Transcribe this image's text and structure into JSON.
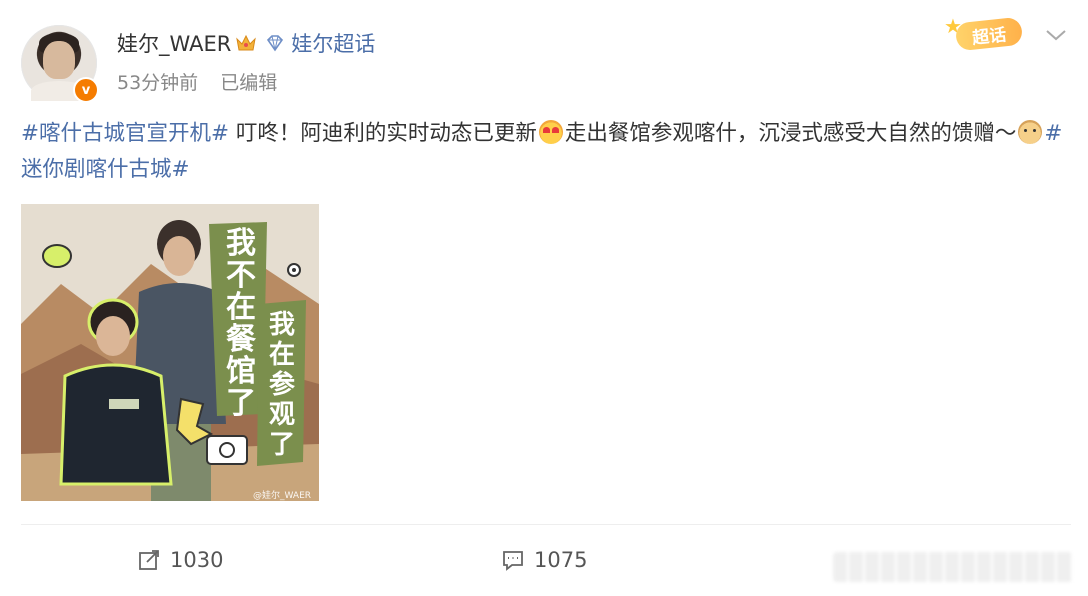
{
  "post": {
    "username": "娃尔_WAER",
    "super_topic_link": "娃尔超话",
    "time": "53分钟前",
    "edited": "已编辑",
    "verified_badge": "v",
    "super_badge": "超话",
    "text": {
      "tag1": "#喀什古城官宣开机#",
      "body1": " 叮咚！阿迪利的实时动态已更新",
      "body2": "走出餐馆参观喀什，沉浸式感受大自然的馈赠～",
      "tag2": "#迷你剧喀什古城#"
    },
    "image": {
      "watermark": "@娃尔_WAER",
      "caption_big": "我不在餐馆了",
      "caption_small": "我在参观了"
    },
    "icons": {
      "crown": "crown-icon",
      "diamond": "diamond-icon",
      "chevron": "chevron-down-icon",
      "heart_eyes": "heart-eyes-emoji",
      "doge": "doge-emoji",
      "repost": "repost-icon",
      "comment": "comment-icon"
    }
  },
  "actions": {
    "repost_count": "1030",
    "comment_count": "1075"
  },
  "colors": {
    "link": "#4b6ea8",
    "meta": "#888888",
    "badge_orange": "#f57c00",
    "green_accent": "#d7ef6a"
  }
}
